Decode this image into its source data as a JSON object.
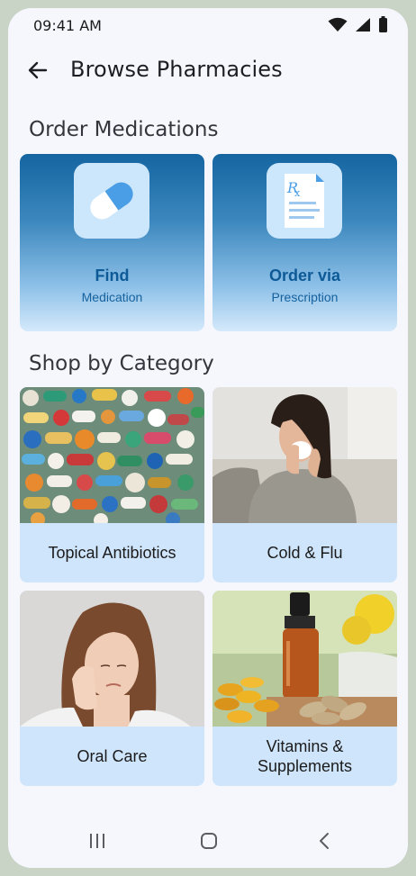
{
  "status_bar": {
    "time": "09:41 AM"
  },
  "header": {
    "title": "Browse Pharmacies",
    "back_icon": "arrow-left-icon"
  },
  "order_section": {
    "heading": "Order Medications",
    "cards": [
      {
        "title": "Find",
        "subtitle": "Medication",
        "icon": "pill-capsule-icon"
      },
      {
        "title": "Order via",
        "subtitle": "Prescription",
        "icon": "prescription-rx-icon"
      }
    ]
  },
  "category_section": {
    "heading": "Shop by Category",
    "categories": [
      {
        "label": "Topical Antibiotics"
      },
      {
        "label": "Cold & Flu"
      },
      {
        "label": "Oral Care"
      },
      {
        "label": "Vitamins & Supplements"
      }
    ]
  },
  "nav_bar": {
    "icons": [
      "recent-apps-icon",
      "home-icon",
      "back-chevron-icon"
    ]
  },
  "colors": {
    "accent": "#0e5a97",
    "card_bg": "#cfe5fb",
    "page_bg": "#f5f7fd"
  }
}
